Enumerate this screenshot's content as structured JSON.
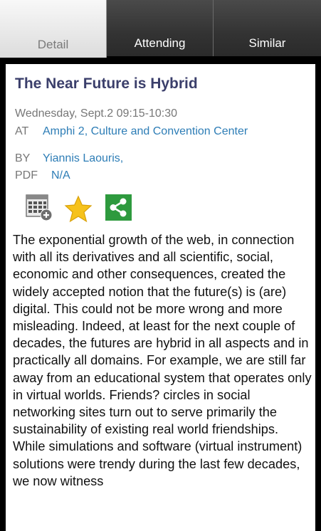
{
  "tabs": [
    {
      "label": "Detail",
      "active": true
    },
    {
      "label": "Attending",
      "active": false
    },
    {
      "label": "Similar",
      "active": false
    }
  ],
  "session": {
    "title": "The Near Future is Hybrid",
    "datetime": "Wednesday, Sept.2 09:15-10:30",
    "at_label": "AT",
    "location": "Amphi 2, Culture and Convention Center",
    "by_label": "BY",
    "speaker": "Yiannis Laouris,",
    "pdf_label": "PDF",
    "pdf_value": "N/A",
    "description": "The exponential growth of the web, in connection with all its derivatives and all scientific, social, economic and other consequences, created the widely accepted notion that the future(s) is (are) digital. This could not be more wrong and more misleading. Indeed, at least for the next couple of decades, the futures are hybrid in all aspects and in practically all domains. For example, we are still far away from an educational system that operates only in virtual worlds. Friends? circles in social networking sites turn out to serve primarily the sustainability of existing real world friendships. While simulations and software (virtual instrument) solutions were trendy during the last few decades, we now witness"
  },
  "actions": {
    "icons": [
      "add-to-calendar-icon",
      "favorite-star-icon",
      "share-icon"
    ],
    "colors": {
      "star": "#f6c21b",
      "share": "#2e9a3e",
      "link": "#2d7db6",
      "title": "#3b3f6b"
    }
  }
}
